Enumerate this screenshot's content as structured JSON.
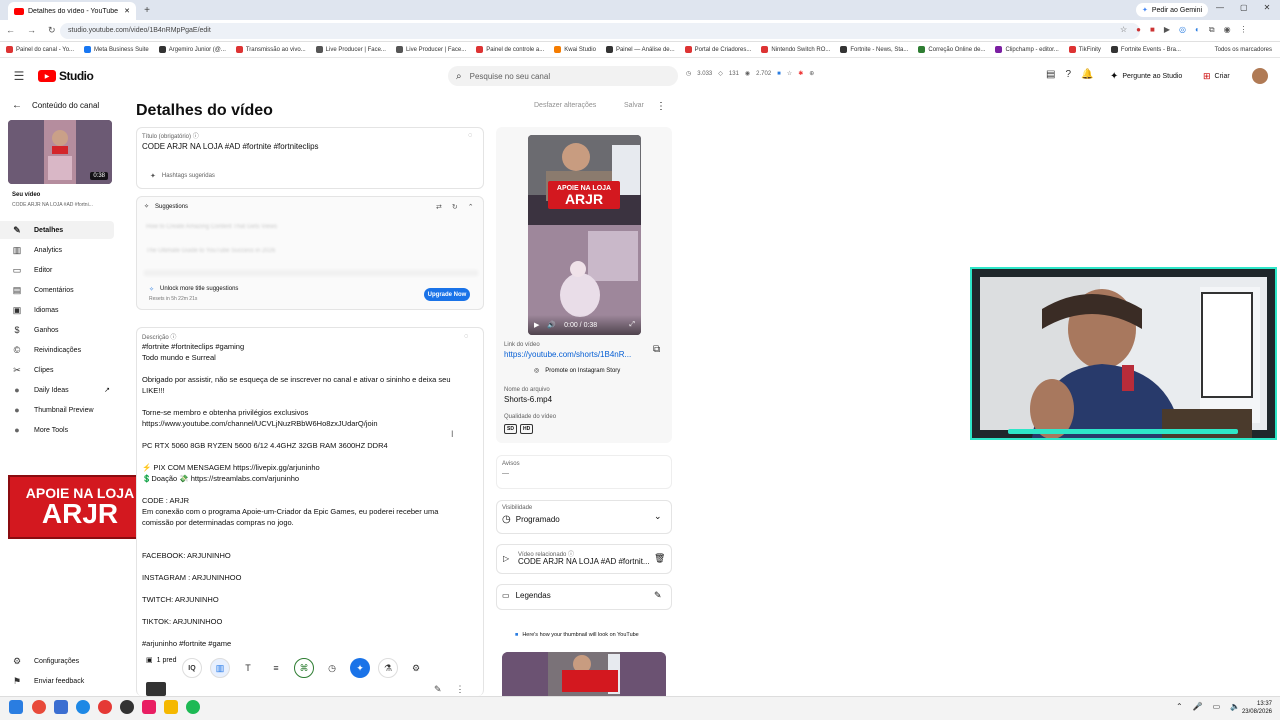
{
  "browser": {
    "tab_title": "Detalhes do vídeo - YouTube S",
    "url": "studio.youtube.com/video/1B4nRMpPgaE/edit",
    "gemini_label": "Pedir ao Gemini",
    "bookmarks": [
      "Painel do canal - Yo...",
      "Meta Business Suite",
      "Argemiro Junior (@...",
      "Transmissão ao vivo...",
      "Live Producer | Face...",
      "Live Producer | Face...",
      "Painel de controle a...",
      "Kwai Studio",
      "Painel — Análise de...",
      "Portal de Criadores...",
      "Nintendo Switch RO...",
      "Fortnite - News, Sta...",
      "Correção Online de...",
      "Clipchamp - editor...",
      "TikFinity",
      "Fortnite Events - Bra..."
    ],
    "bookmarks_all": "Todos os marcadores"
  },
  "studio": {
    "logo_text": "Studio",
    "search_placeholder": "Pesquise no seu canal",
    "stat1": "3.033",
    "stat2": "131",
    "stat3": "2.702",
    "ask_label": "Pergunte ao Studio",
    "create_label": "Criar"
  },
  "sidebar": {
    "back_label": "Conteúdo do canal",
    "thumb_duration": "0:38",
    "your_video": "Seu vídeo",
    "video_title_short": "CODE ARJR NA LOJA #AD #fortni...",
    "items": [
      "Detalhes",
      "Analytics",
      "Editor",
      "Comentários",
      "Idiomas",
      "Ganhos",
      "Reivindicações",
      "Clipes",
      "Daily Ideas",
      "Thumbnail Preview",
      "More Tools"
    ],
    "settings": "Configurações",
    "feedback": "Enviar feedback"
  },
  "page": {
    "title": "Detalhes do vídeo",
    "undo_label": "Desfazer alterações",
    "save_label": "Salvar"
  },
  "title_field": {
    "label": "Título (obrigatório)",
    "value": "CODE ARJR NA LOJA #AD  #fortnite #fortniteclips",
    "hashtags": "Hashtags sugeridas"
  },
  "suggestions": {
    "label": "Suggestions",
    "item1": "How to Create Amazing Content That Gets Views",
    "item2": "The Ultimate Guide to YouTube Success in 2026",
    "unlock": "Unlock more title suggestions",
    "resets": "Resets in 5h 22m 21s",
    "upgrade": "Upgrade Now"
  },
  "description": {
    "label": "Descrição",
    "lines": [
      "#fortnite #fortniteclips #gaming",
      "Todo mundo  e Surreal",
      "",
      "Obrigado por assistir, não se esqueça de se inscrever no canal e ativar o sininho e  deixa seu",
      "LIKE!!!",
      "",
      "Torne-se membro e obtenha privilégios exclusivos",
      "https://www.youtube.com/channel/UCVLjNuzRBbW6Ho8zxJUdarQ/join",
      "",
      "PC RTX 5060 8GB  RYZEN 5600  6/12 4.4GHZ 32GB RAM 3600HZ DDR4",
      "",
      "⚡ PIX COM MENSAGEM https://livepix.gg/arjuninho",
      "💲Doação 💸 https://streamlabs.com/arjuninho",
      "",
      "CODE : ARJR",
      "Em conexão com o programa Apoie-um-Criador da Epic Games, eu poderei receber uma",
      "comissão por determinadas compras no jogo.",
      "",
      "",
      "FACEBOOK: ARJUNINHO",
      "",
      "INSTAGRAM : ARJUNINHOO",
      "",
      "TWITCH:  ARJUNINHO",
      "",
      "TIKTOK: ARJUNINHOO",
      "",
      "#arjuninho #fortnite #game"
    ],
    "pred_label": "1 pred"
  },
  "preview": {
    "banner_line1": "APOIE NA LOJA",
    "banner_line2": "ARJR",
    "time": "0:00 / 0:38",
    "link_label": "Link do vídeo",
    "link_value": "https://youtube.com/shorts/1B4nR...",
    "instagram": "Promote on Instagram Story",
    "file_label": "Nome do arquivo",
    "file_value": "Shorts-6.mp4",
    "quality_label": "Qualidade do vídeo",
    "quality_sd": "SD",
    "quality_hd": "HD"
  },
  "warnings": {
    "label": "Avisos",
    "value": "—"
  },
  "visibility": {
    "label": "Visibilidade",
    "value": "Programado"
  },
  "related": {
    "label": "Vídeo relacionado",
    "value": "CODE ARJR NA LOJA #AD #fortnit..."
  },
  "captions": {
    "label": "Legendas"
  },
  "thumb_note": "Here's how your thumbnail will look on YouTube",
  "overlay_banner": {
    "line1": "APOIE NA LOJA",
    "line2": "ARJR"
  },
  "taskbar": {
    "time": "13:37",
    "date": "23/08/2026"
  },
  "colors": {
    "accent": "#065fd4",
    "brand": "#ff0000",
    "webcam_border": "#2ee6c8"
  }
}
